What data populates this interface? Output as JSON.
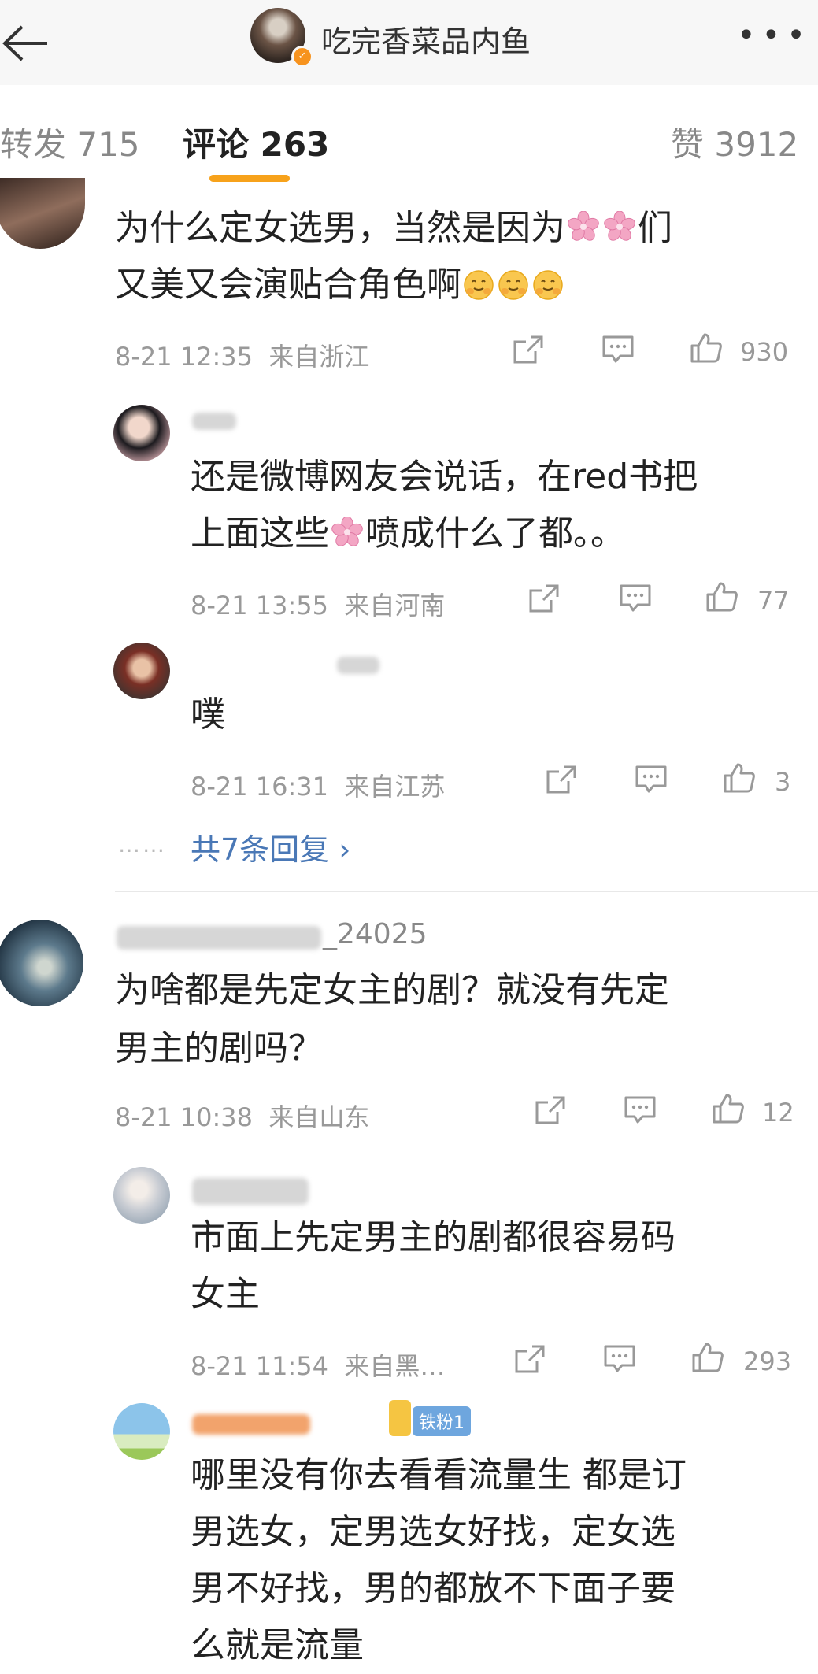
{
  "header": {
    "title": "吃完香菜品内鱼",
    "back_icon": "back-arrow-icon",
    "more_icon": "more-icon",
    "more_label": "•••"
  },
  "tabs": [
    {
      "label": "转发 715",
      "active": false
    },
    {
      "label": "评论 263",
      "active": true
    },
    {
      "label": "赞 3912",
      "active": false
    }
  ],
  "comments": [
    {
      "text_line1": "为什么定女选男，当然是因为",
      "text_line1_after_flowers": "们",
      "text_line2": "又美又会演贴合角色啊",
      "time": "8-21 12:35",
      "location": "来自浙江",
      "likes": "930"
    },
    {
      "text_line1": "还是微博网友会说话，在red书把",
      "text_line2_before_flower": "上面这些",
      "text_line2_after_flower": "喷成什么了都。。",
      "time": "8-21 13:55",
      "location": "来自河南",
      "likes": "77"
    },
    {
      "text": "噗",
      "time": "8-21 16:31",
      "location": "来自江苏",
      "likes": "3"
    },
    {
      "more_replies": "共7条回复 ›",
      "dots": "……"
    },
    {
      "username_suffix": "_24025",
      "text_line1": "为啥都是先定女主的剧？就没有先定",
      "text_line2": "男主的剧吗？",
      "time": "8-21 10:38",
      "location": "来自山东",
      "likes": "12"
    },
    {
      "text_line1": "市面上先定男主的剧都很容易码",
      "text_line2": "女主",
      "time": "8-21 11:54",
      "location": "来自黑…",
      "likes": "293"
    },
    {
      "badge": "铁粉1",
      "text_line1": "哪里没有你去看看流量生 都是订",
      "text_line2": "男选女，定男选女好找，定女选",
      "text_line3": "男不好找，男的都放不下面子要",
      "text_line4": "么就是流量"
    }
  ],
  "icons": {
    "share": "share-icon",
    "comment": "comment-icon",
    "like": "thumbs-up-icon",
    "flower": "cherry-blossom-icon",
    "emoji": "hugging-face-emoji-icon"
  },
  "colors": {
    "accent": "#f7a21b",
    "link": "#4a78b6",
    "meta": "#999999",
    "badge": "#6ea6de"
  }
}
